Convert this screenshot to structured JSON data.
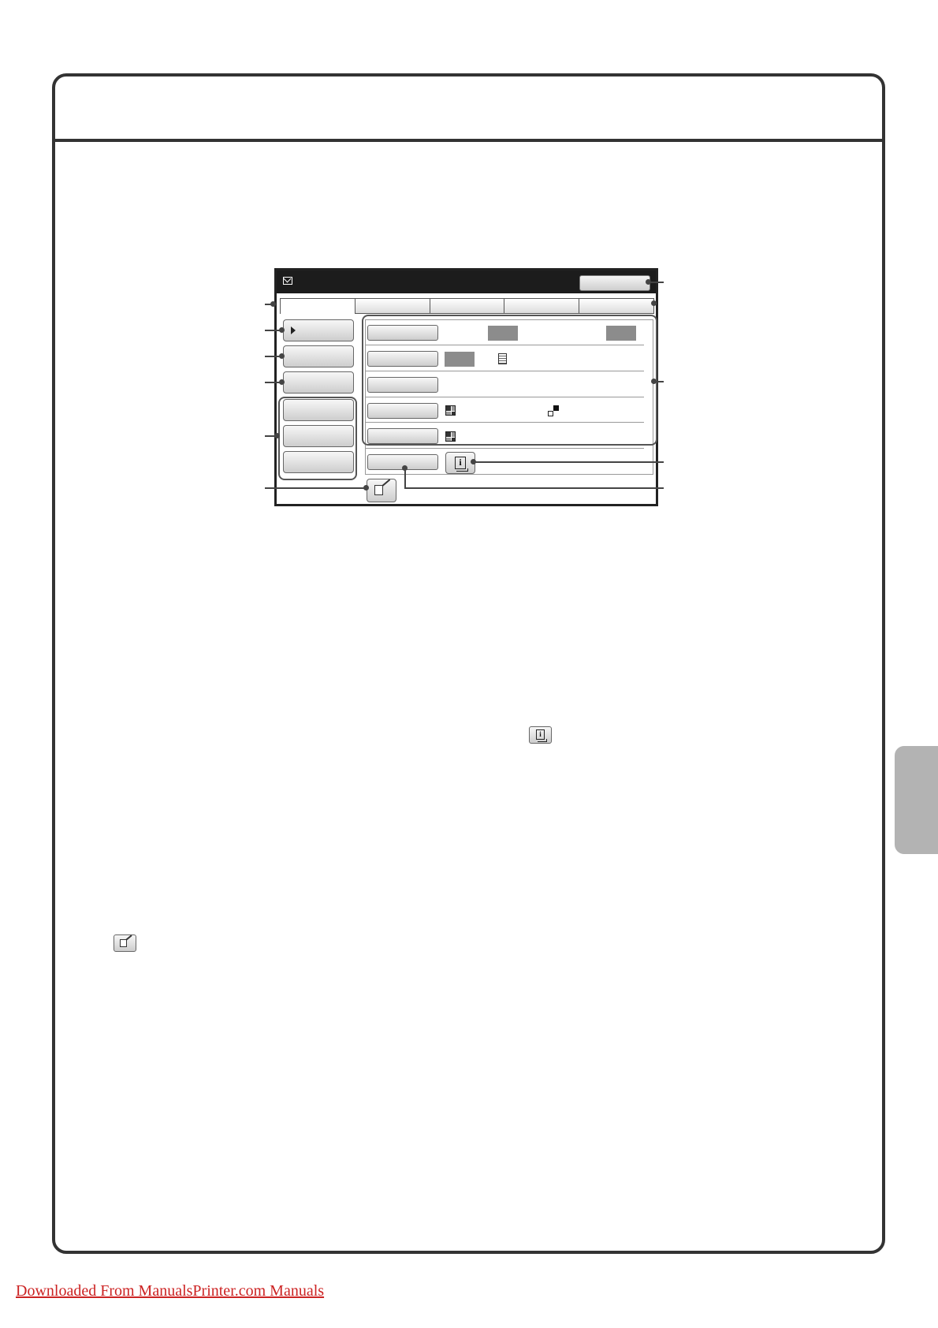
{
  "footer": {
    "link_text": "Downloaded From ManualsPrinter.com Manuals"
  },
  "colors": {
    "frame": "#333333",
    "side_tab": "#b3b3b3",
    "link": "#cc2222",
    "titlebar": "#1c1c1c",
    "highlight_box": "#8c8c8c"
  },
  "icons": {
    "titlebar": "mail-icon",
    "info_button": "info-icon",
    "edit_button": "edit-icon",
    "exposure": "quad-tone-icon",
    "resolution": "corner-squares-icon",
    "original": "document-icon"
  }
}
